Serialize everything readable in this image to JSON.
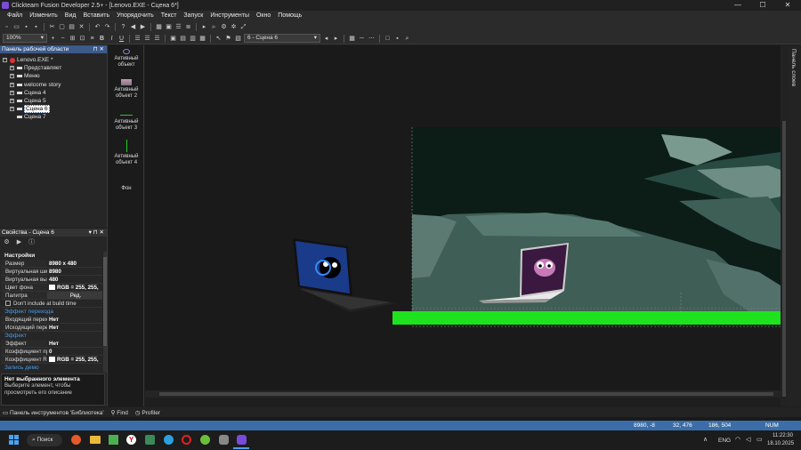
{
  "window": {
    "title": "Clickteam Fusion Developer 2.5+ - [Lenovo.EXE - Сцена 6*]",
    "controls": {
      "minimize": "—",
      "maximize": "☐",
      "close": "✕"
    }
  },
  "menu": [
    "Файл",
    "Изменить",
    "Вид",
    "Вставить",
    "Упорядочить",
    "Текст",
    "Запуск",
    "Инструменты",
    "Окно",
    "Помощь"
  ],
  "toolbar": {
    "zoom": "100%",
    "frame_select": "6 - Сцена 6"
  },
  "workspace": {
    "title": "Панель рабочей области",
    "pin": "⊓ ✕",
    "app": "Lenovo.EXE *",
    "items": [
      {
        "label": "Представляет",
        "expandable": true,
        "selected": false
      },
      {
        "label": "Меню",
        "expandable": true,
        "selected": false
      },
      {
        "label": "welcome story",
        "expandable": true,
        "selected": false
      },
      {
        "label": "Сцена 4",
        "expandable": true,
        "selected": false
      },
      {
        "label": "Сцена 5",
        "expandable": true,
        "selected": false
      },
      {
        "label": "Сцена 6",
        "expandable": true,
        "selected": true
      },
      {
        "label": "Сцена 7",
        "expandable": false,
        "selected": false
      }
    ]
  },
  "properties": {
    "title": "Свойства - Сцена 6",
    "section_settings": "Настройки",
    "rows1": [
      {
        "key": "Размер",
        "value": "8980 x 480"
      },
      {
        "key": "Виртуальная шир",
        "value": "8980"
      },
      {
        "key": "Виртуальная выс",
        "value": "480"
      },
      {
        "key": "Цвет фона",
        "value": "RGB = 255, 255,"
      },
      {
        "key": "Палитра",
        "value": "Ред."
      }
    ],
    "dont_include": "Don't include at build time",
    "section_transition": "Эффект перехода",
    "rows2": [
      {
        "key": "Входящий перех",
        "value": "Нет"
      },
      {
        "key": "Исходящий перех",
        "value": "Нет"
      }
    ],
    "section_effect": "Эффект",
    "rows3": [
      {
        "key": "Эффект",
        "value": "Нет"
      },
      {
        "key": "Коэффициент пр",
        "value": "0"
      },
      {
        "key": "Коэффициент RG",
        "value": "RGB = 255, 255,"
      }
    ],
    "section_demo": "Запись демо",
    "help_title": "Нет выбранного элемента",
    "help_text": "Выберите элемент, чтобы просмотреть его описание"
  },
  "objects": [
    {
      "label": "Активный объект"
    },
    {
      "label": "Активный объект 2"
    },
    {
      "label": "Активный объект 3"
    },
    {
      "label": "Активный объект 4"
    },
    {
      "label": "Фон"
    }
  ],
  "right_panel": "Панель слоев",
  "bottom_tabs": [
    "Панель инструментов 'Библиотека'",
    "Find",
    "Profiler"
  ],
  "status": {
    "coords1": "8980, -8",
    "coords2": "32, 476",
    "coords3": "186, 504",
    "mode": "NUM"
  },
  "taskbar": {
    "search": "Поиск",
    "lang": "ENG",
    "time": "11:22:30",
    "date": "18.10.2025"
  },
  "colors": {
    "accent": "#3b6ea8",
    "ground": "#1fe21f"
  }
}
